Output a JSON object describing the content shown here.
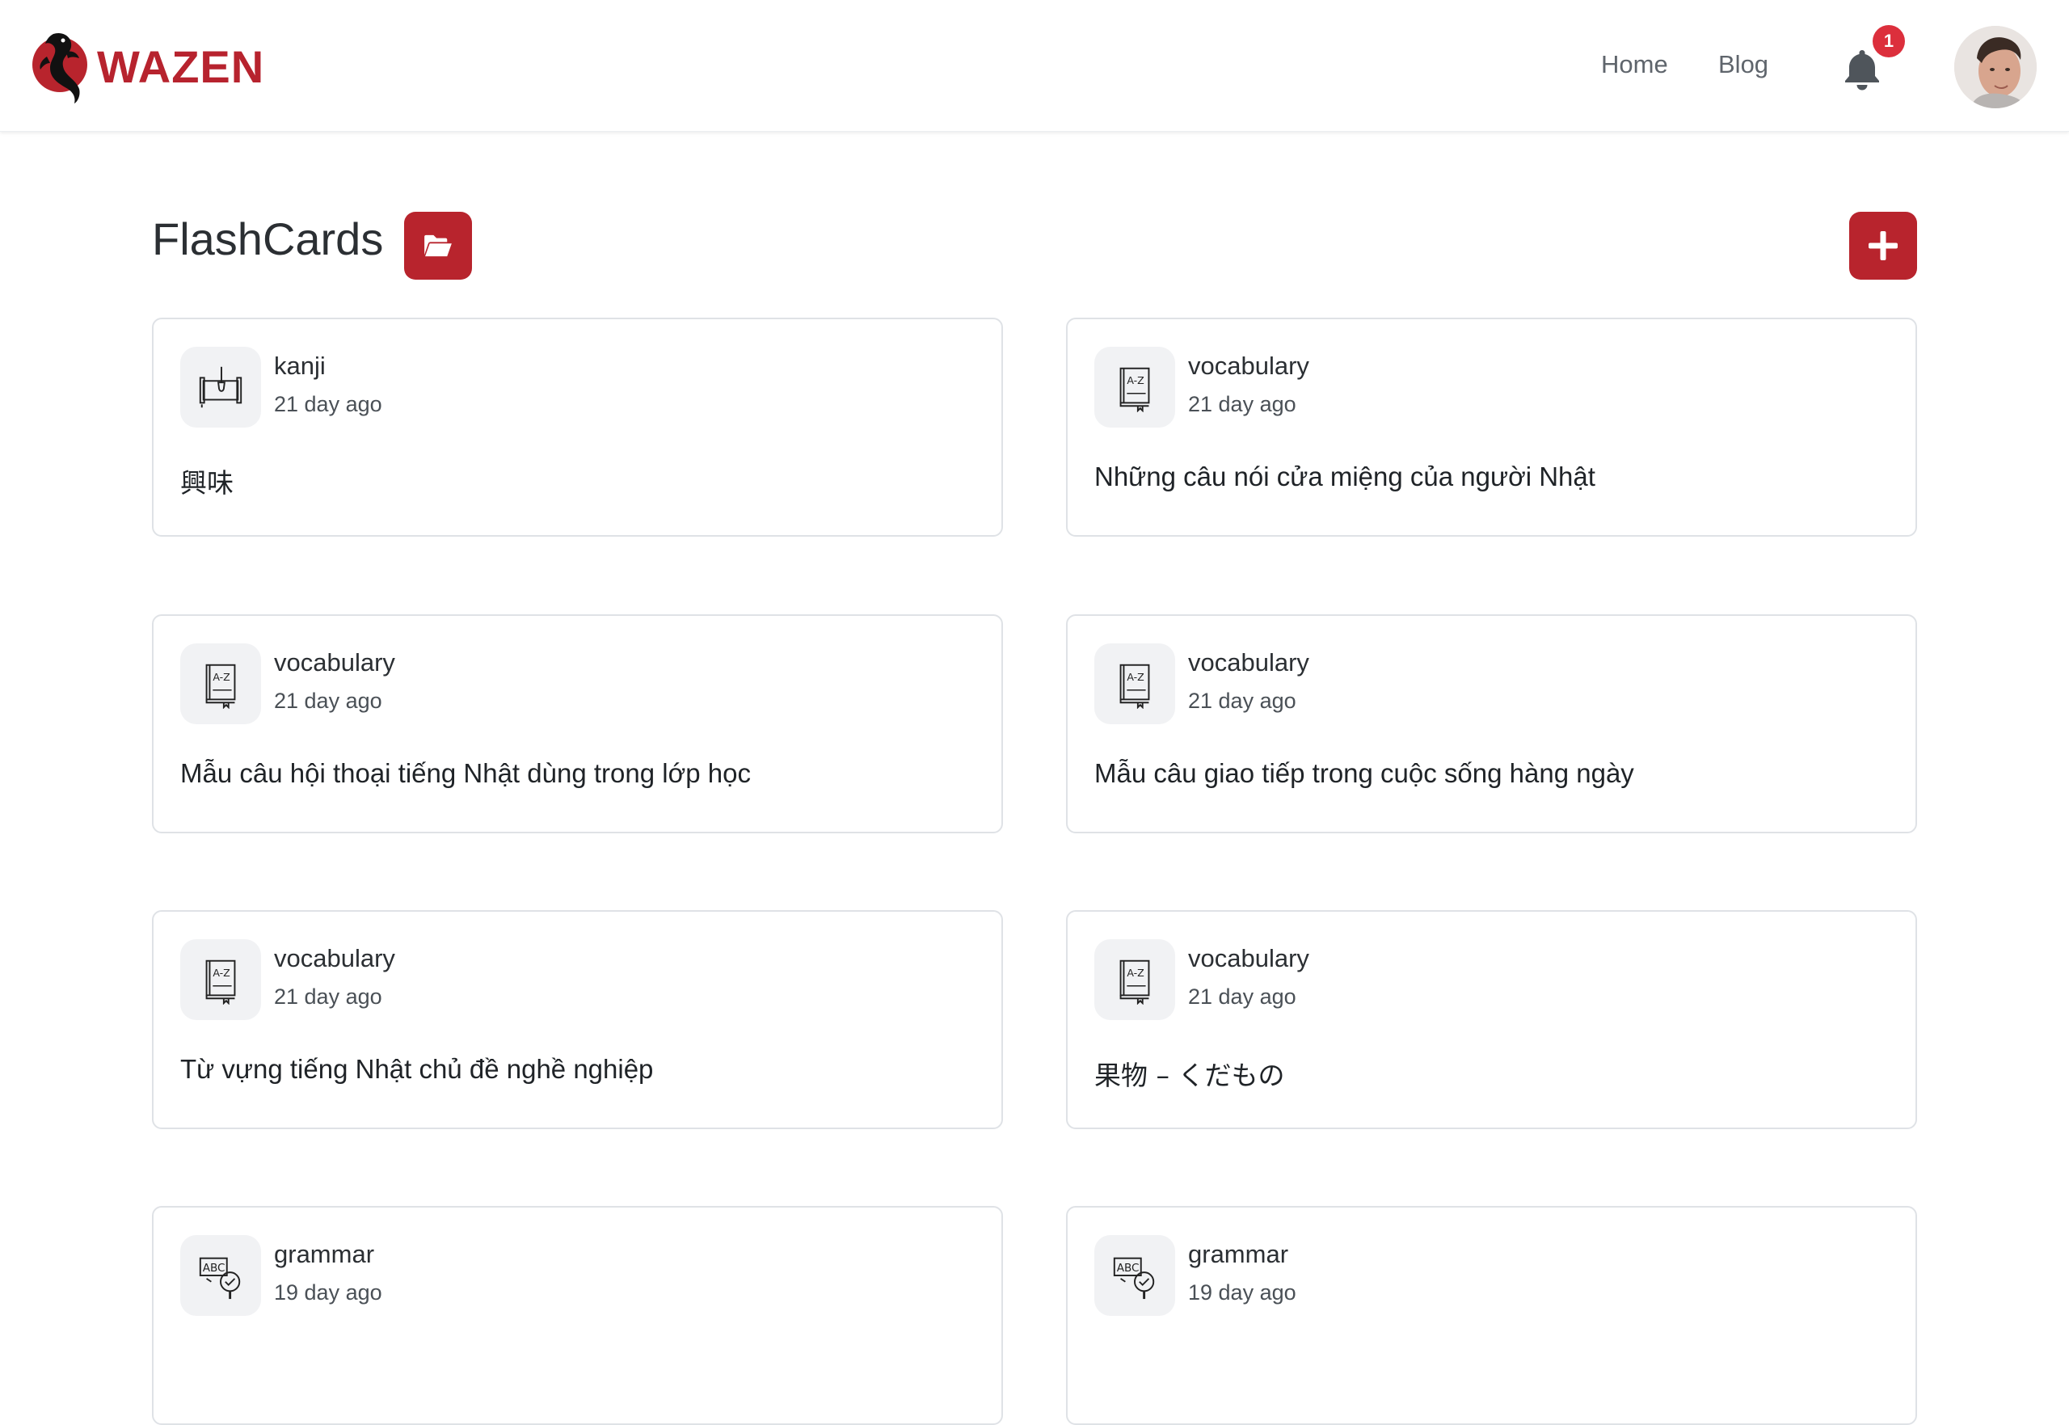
{
  "brand": {
    "name": "WAZEN",
    "color": "#b7232e"
  },
  "nav": {
    "home_label": "Home",
    "blog_label": "Blog",
    "notification_count": "1"
  },
  "page": {
    "title": "FlashCards"
  },
  "icons": {
    "folder_button": "folder-open-icon",
    "add_button": "plus-icon",
    "kanji": "scroll-brush-icon",
    "vocabulary": "az-book-icon",
    "grammar": "abc-magnifier-icon"
  },
  "cards": [
    {
      "category": "kanji",
      "time": "21 day ago",
      "title": "興味"
    },
    {
      "category": "vocabulary",
      "time": "21 day ago",
      "title": "Những câu nói cửa miệng của người Nhật"
    },
    {
      "category": "vocabulary",
      "time": "21 day ago",
      "title": "Mẫu câu hội thoại tiếng Nhật dùng trong lớp học"
    },
    {
      "category": "vocabulary",
      "time": "21 day ago",
      "title": "Mẫu câu giao tiếp trong cuộc sống hàng ngày"
    },
    {
      "category": "vocabulary",
      "time": "21 day ago",
      "title": "Từ vựng tiếng Nhật chủ đề nghề nghiệp"
    },
    {
      "category": "vocabulary",
      "time": "21 day ago",
      "title": "果物 – くだもの"
    },
    {
      "category": "grammar",
      "time": "19 day ago",
      "title": ""
    },
    {
      "category": "grammar",
      "time": "19 day ago",
      "title": ""
    }
  ]
}
